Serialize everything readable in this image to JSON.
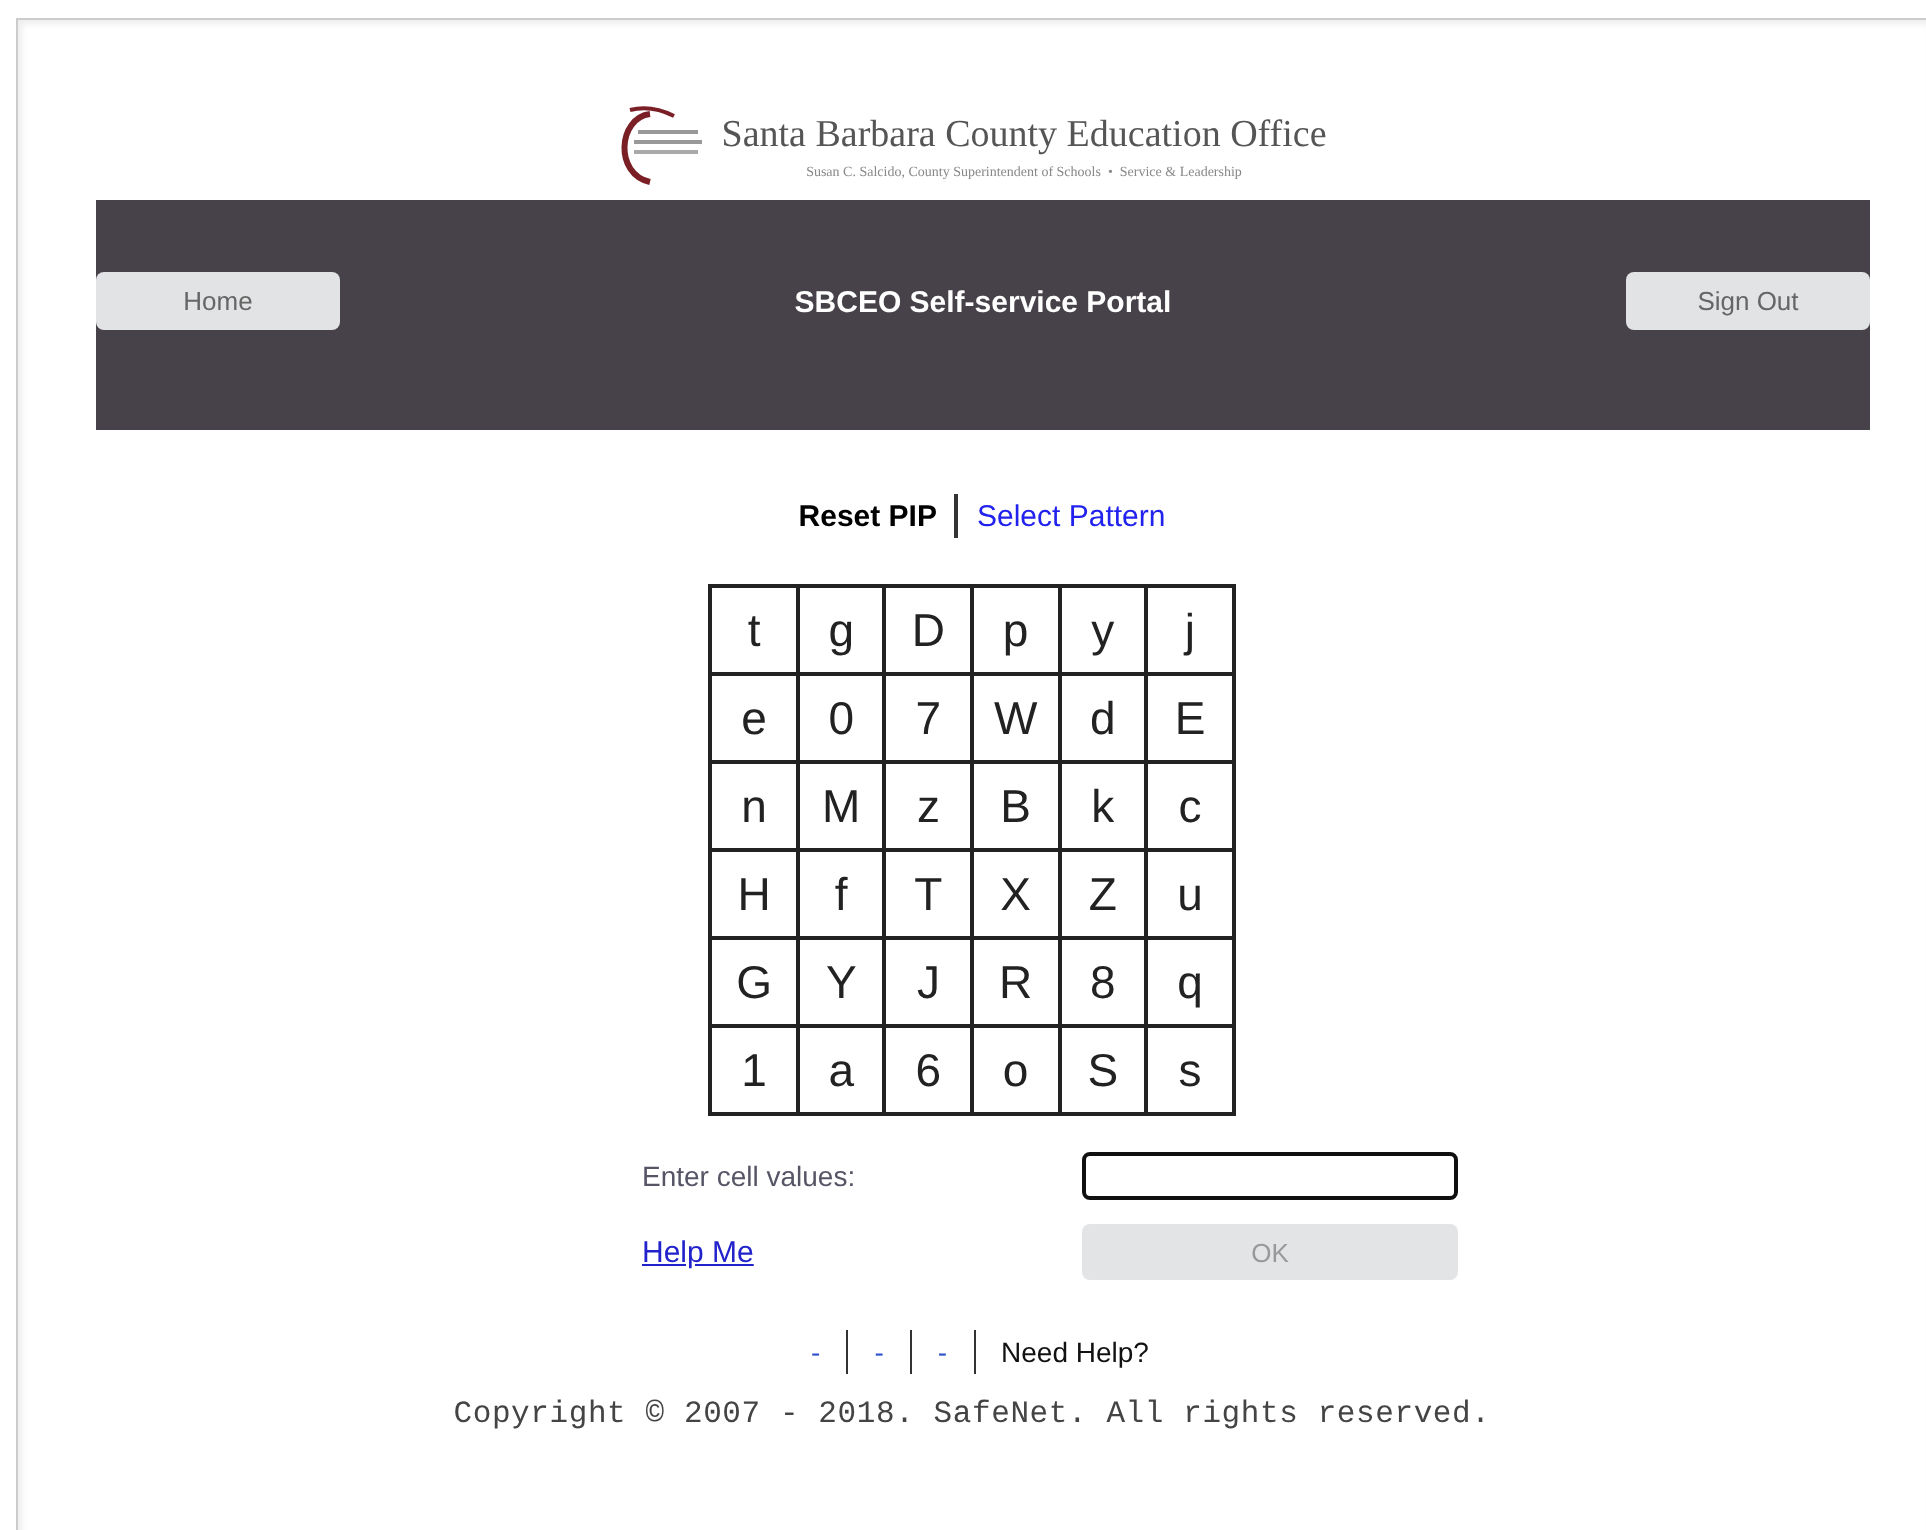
{
  "logo": {
    "title": "Santa Barbara County Education Office",
    "subtitle": "Susan C. Salcido, County Superintendent of Schools  •  Service & Leadership"
  },
  "header": {
    "title": "SBCEO Self-service Portal",
    "left_button": "Home",
    "right_button": "Sign Out"
  },
  "tabs": [
    {
      "label": "Reset PIP",
      "selected": true
    },
    {
      "label": "Select Pattern",
      "selected": false
    }
  ],
  "grid": [
    [
      "t",
      "g",
      "D",
      "p",
      "y",
      "j"
    ],
    [
      "e",
      "0",
      "7",
      "W",
      "d",
      "E"
    ],
    [
      "n",
      "M",
      "z",
      "B",
      "k",
      "c"
    ],
    [
      "H",
      "f",
      "T",
      "X",
      "Z",
      "u"
    ],
    [
      "G",
      "Y",
      "J",
      "R",
      "8",
      "q"
    ],
    [
      "1",
      "a",
      "6",
      "o",
      "S",
      "s"
    ]
  ],
  "form": {
    "label": "Enter cell values:",
    "help_link": "Help Me",
    "ok_button": "OK",
    "ok_disabled": true
  },
  "footer": {
    "links": [
      {
        "text": "-",
        "kind": "link"
      },
      {
        "text": "-",
        "kind": "link"
      },
      {
        "text": "-",
        "kind": "link"
      },
      {
        "text": "Need Help?",
        "kind": "text"
      }
    ],
    "copyright": "Copyright © 2007 - 2018. SafeNet. All rights reserved."
  }
}
